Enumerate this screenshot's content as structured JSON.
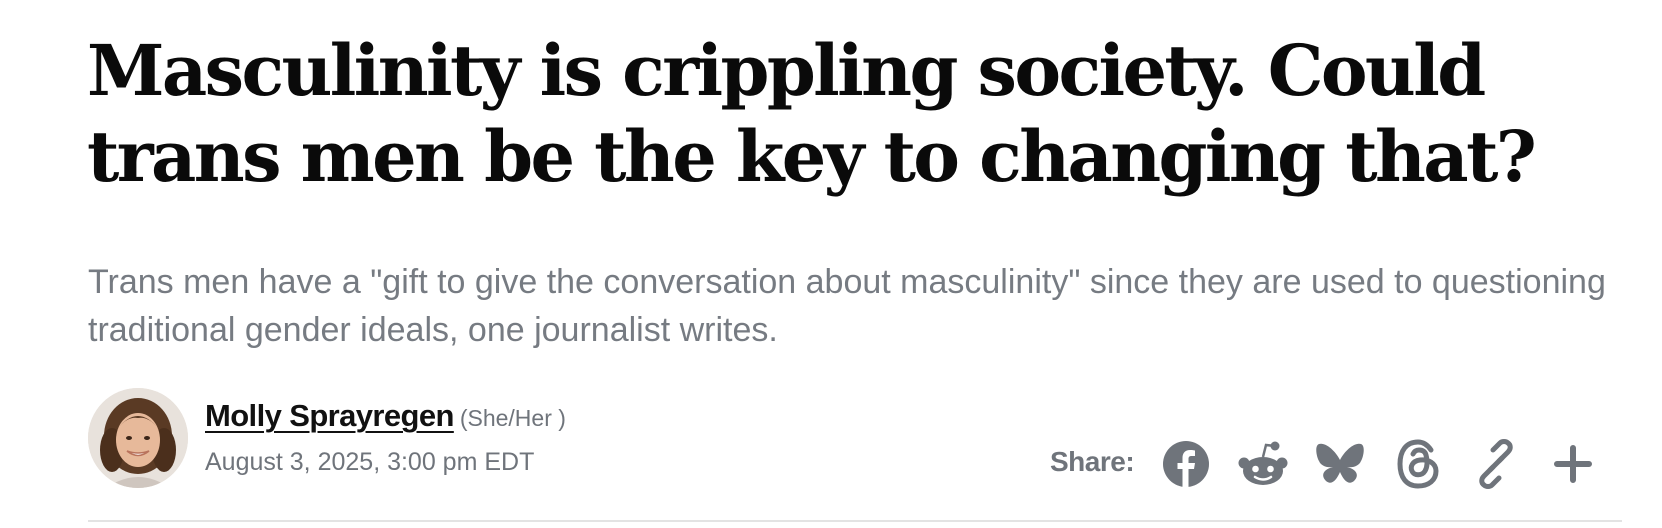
{
  "article": {
    "headline": "Masculinity is crippling society. Could trans men be the key to changing that?",
    "dek": "Trans men have a \"gift to give the conversation about masculinity\" since they are used to questioning traditional gender ideals, one journalist writes."
  },
  "byline": {
    "author": "Molly Sprayregen",
    "pronouns": "(She/Her )",
    "date": "August 3, 2025, 3:00 pm EDT"
  },
  "share": {
    "label": "Share:",
    "buttons": [
      {
        "icon": "facebook-icon"
      },
      {
        "icon": "reddit-icon"
      },
      {
        "icon": "bluesky-icon"
      },
      {
        "icon": "threads-icon"
      },
      {
        "icon": "link-icon"
      },
      {
        "icon": "plus-icon"
      }
    ]
  },
  "colors": {
    "headline": "#0a0a0a",
    "muted": "#767b82",
    "icon": "#6f747b"
  }
}
